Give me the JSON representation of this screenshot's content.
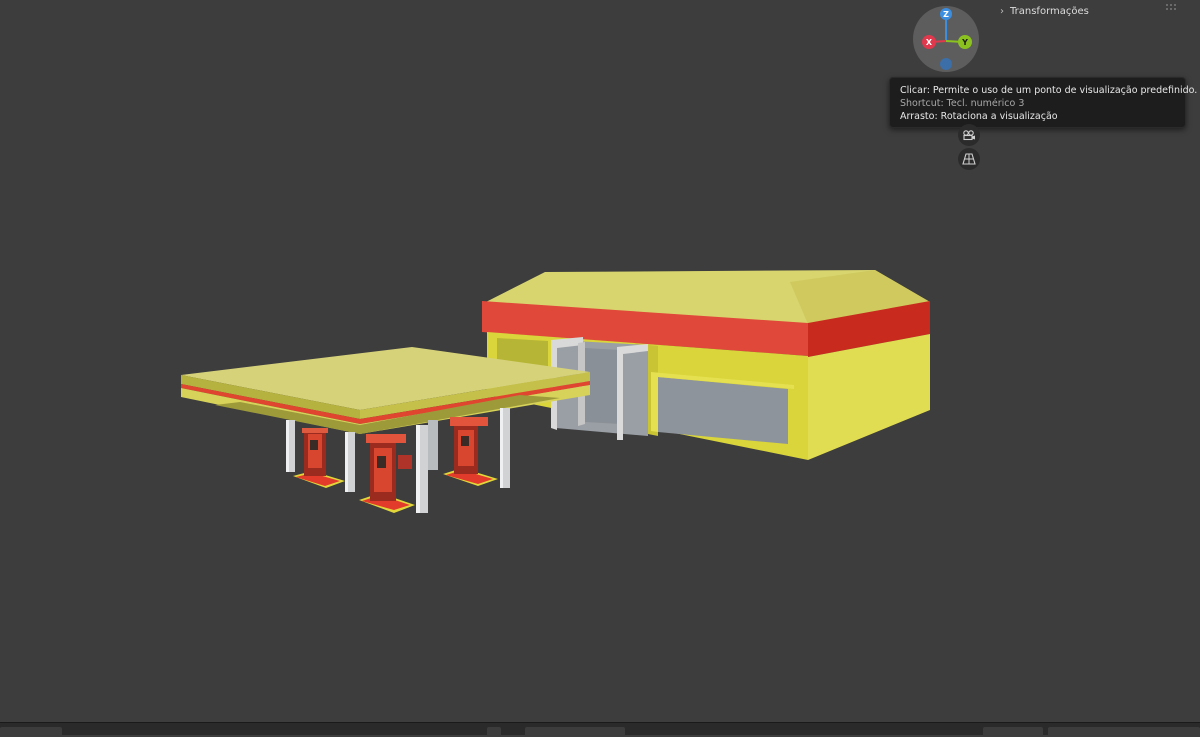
{
  "sidebar": {
    "transform_panel_label": "Transformações"
  },
  "gizmo": {
    "z_label": "Z",
    "x_label": "X",
    "y_label": "Y",
    "colors": {
      "x": "#e0394d",
      "y": "#8bc21f",
      "z": "#3c8fe0"
    }
  },
  "tooltip": {
    "line1": "Clicar: Permite o uso de um ponto de visualização predefinido.",
    "line2": "Shortcut: Tecl. numérico 3",
    "line3": "Arrasto: Rotaciona a visualização"
  },
  "icons": {
    "camera": "camera-view-icon",
    "grid": "grid-perspective-icon",
    "panel_toggle": "chevron-right-icon"
  },
  "scene_colors": {
    "background": "#3d3d3d",
    "roof_yellow": "#d8d46b",
    "wall_yellow": "#d9d63a",
    "fascia_red": "#d9382a",
    "glass": "#8f959c",
    "frame": "#d6d6d6"
  }
}
